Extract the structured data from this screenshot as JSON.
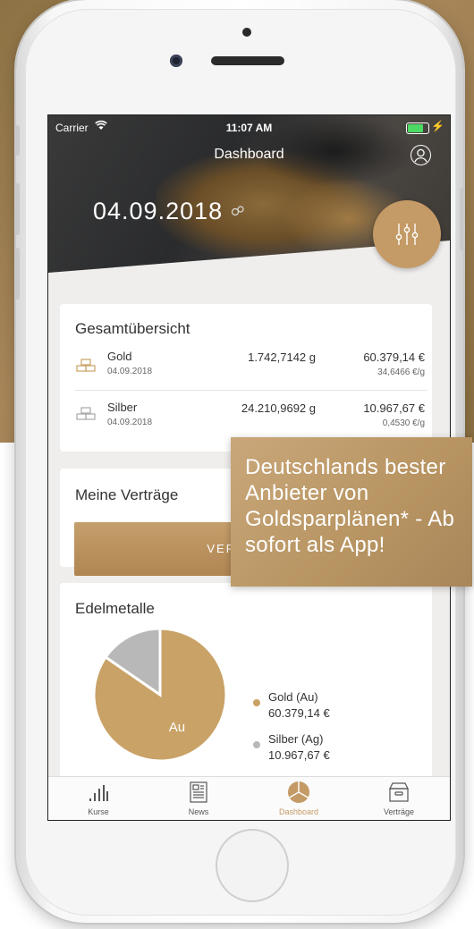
{
  "colors": {
    "accent": "#c49a66",
    "gold": "#c9a267",
    "silver": "#b8b8b8"
  },
  "status_bar": {
    "carrier": "Carrier",
    "time": "11:07 AM"
  },
  "nav": {
    "title": "Dashboard"
  },
  "hero": {
    "date": "04.09.2018"
  },
  "overview": {
    "title": "Gesamtübersicht",
    "rows": [
      {
        "name": "Gold",
        "date": "04.09.2018",
        "weight": "1.742,7142 g",
        "value": "60.379,14 €",
        "rate": "34,6466 €/g"
      },
      {
        "name": "Silber",
        "date": "04.09.2018",
        "weight": "24.210,9692 g",
        "value": "10.967,67 €",
        "rate": "0,4530 €/g"
      }
    ]
  },
  "contracts": {
    "title": "Meine Verträge",
    "button_label": "VERTRÄGE"
  },
  "metals": {
    "title": "Edelmetalle",
    "legend": [
      {
        "label": "Gold (Au)",
        "value": "60.379,14 €"
      },
      {
        "label": "Silber (Ag)",
        "value": "10.967,67 €"
      }
    ],
    "slice_label": "Au"
  },
  "chart_data": {
    "type": "pie",
    "categories": [
      "Gold (Au)",
      "Silber (Ag)"
    ],
    "values": [
      60379.14,
      10967.67
    ],
    "slice_labels": [
      "Au",
      ""
    ]
  },
  "tabbar": {
    "tabs": [
      {
        "label": "Kurse",
        "icon": "bar-chart-icon"
      },
      {
        "label": "News",
        "icon": "newspaper-icon"
      },
      {
        "label": "Dashboard",
        "icon": "dashboard-pie-icon"
      },
      {
        "label": "Verträge",
        "icon": "archive-box-icon"
      }
    ]
  },
  "promo": {
    "text": "Deutschlands bester Anbieter von Goldsparplänen* - Ab sofort als App!"
  }
}
